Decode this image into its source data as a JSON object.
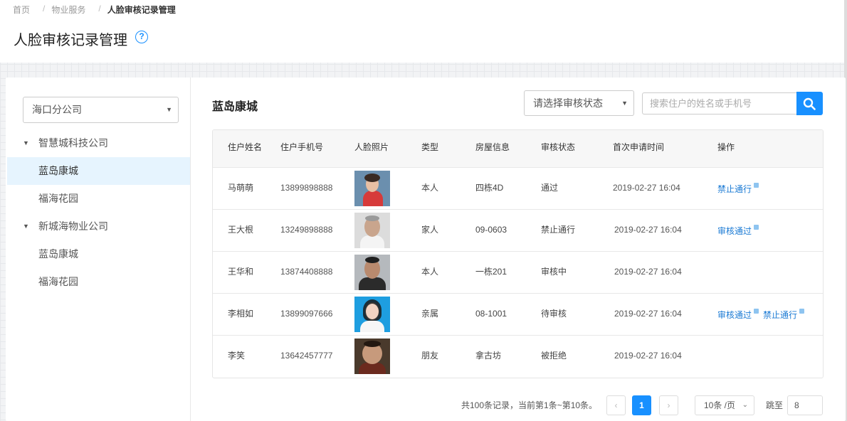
{
  "breadcrumb": [
    "首页",
    "物业服务",
    "人脸审核记录管理"
  ],
  "page_title": "人脸审核记录管理",
  "help_icon": "question-circle-icon",
  "sidebar": {
    "company_select": "海口分公司",
    "tree": [
      {
        "label": "智慧城科技公司",
        "type": "group",
        "expanded": true
      },
      {
        "label": "蓝岛康城",
        "type": "leaf",
        "active": true
      },
      {
        "label": "福海花园",
        "type": "leaf"
      },
      {
        "label": "新城海物业公司",
        "type": "group",
        "expanded": true
      },
      {
        "label": "蓝岛康城",
        "type": "leaf"
      },
      {
        "label": "福海花园",
        "type": "leaf"
      }
    ]
  },
  "main": {
    "estate_title": "蓝岛康城",
    "status_select_placeholder": "请选择审核状态",
    "search_placeholder": "搜索住户的姓名或手机号",
    "search_icon": "search-icon"
  },
  "table": {
    "headers": [
      "住户姓名",
      "住户手机号",
      "人脸照片",
      "类型",
      "房屋信息",
      "审核状态",
      "首次申请时间",
      "操作"
    ],
    "rows": [
      {
        "name": "马萌萌",
        "phone": "13899898888",
        "type": "本人",
        "house": "四栋4D",
        "status": "通过",
        "time": "2019-02-27 16:04",
        "actions": [
          "禁止通行"
        ]
      },
      {
        "name": "王大根",
        "phone": "13249898888",
        "type": "家人",
        "house": "09-0603",
        "status": "禁止通行",
        "time": "2019-02-27 16:04",
        "actions": [
          "审核通过"
        ]
      },
      {
        "name": "王华和",
        "phone": "13874408888",
        "type": "本人",
        "house": "一栋201",
        "status": "审核中",
        "time": "2019-02-27 16:04",
        "actions": []
      },
      {
        "name": "李相如",
        "phone": "13899097666",
        "type": "亲属",
        "house": "08-1001",
        "status": "待审核",
        "time": "2019-02-27 16:04",
        "actions": [
          "审核通过",
          "禁止通行"
        ]
      },
      {
        "name": "李笑",
        "phone": "13642457777",
        "type": "朋友",
        "house": "拿古坊",
        "status": "被拒绝",
        "time": "2019-02-27 16:04",
        "actions": []
      }
    ]
  },
  "pagination": {
    "summary": "共100条记录，当前第1条~第10条。",
    "prev": "‹",
    "current_page": "1",
    "next": "›",
    "page_size": "10条 /页",
    "jump_label": "跳至",
    "jump_value": "8"
  },
  "colors": {
    "accent": "#1890ff",
    "link": "#1a7ad4",
    "active_row": "#e6f4fe"
  }
}
